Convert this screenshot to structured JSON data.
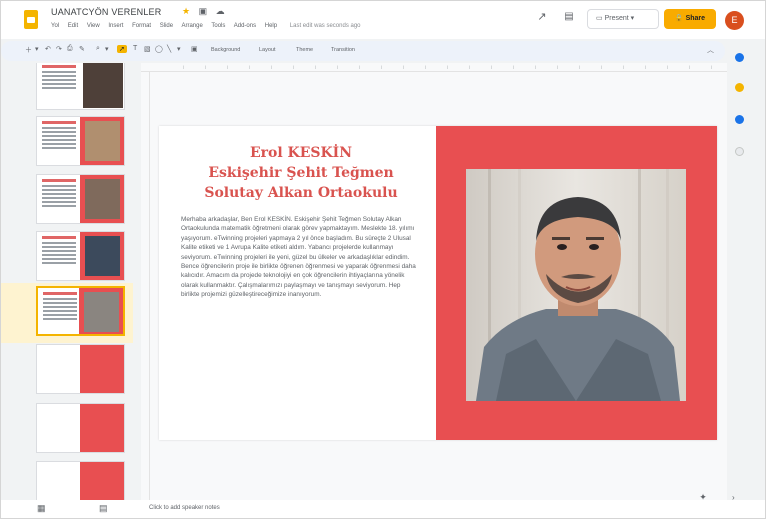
{
  "app": {
    "title": "UANATCYÖN VERENLER",
    "menu": [
      "Yol",
      "Edit",
      "View",
      "Insert",
      "Format",
      "Slide",
      "Arrange",
      "Tools",
      "Add-ons",
      "Help"
    ],
    "last_edit": "Last edit was seconds ago"
  },
  "header": {
    "present_label": "Present",
    "share_label": "Share",
    "avatar_letter": "E"
  },
  "toolbar": {
    "background_label": "Background",
    "layout_label": "Layout",
    "theme_label": "Theme",
    "transition_label": "Transition"
  },
  "filmstrip": {
    "slide_numbers": [
      "",
      "",
      "",
      "",
      "",
      "",
      "",
      ""
    ],
    "selected_index": 4
  },
  "slide": {
    "title_line1": "Erol KESKİN",
    "title_line2": "Eskişehir Şehit Teğmen",
    "title_line3": "Solutay Alkan Ortaokulu",
    "body": "Merhaba arkadaşlar, Ben Erol KESKİN. Eskişehir Şehit Teğmen Solutay Alkan Ortaokulunda matematik öğretmeni olarak görev yapmaktayım. Meslekte 18. yılımı yaşıyorum. eTwinning projeleri yapmaya 2 yıl önce başladım. Bu süreçte 2 Ulusal Kalite etiketi ve 1 Avrupa Kalite etiketi aldım. Yabancı projelerde kullanmayı seviyorum. eTwinning projeleri ile yeni, güzel bu ülkeler ve arkadaşlıklar edindim. Bence öğrencilerin proje ile birlikte öğrenen öğrenmesi ve yaparak öğrenmesi daha kalıcıdır. Amacım da projede teknolojiyi en çok öğrencilerin ihtiyaçlarına yönelik olarak kullanmaktır. Çalışmalarımızı paylaşmayı ve tanışmayı seviyorum. Hep birlikte projemizi güzelleştireceğimize inanıyorum."
  },
  "bottom": {
    "notes_hint": "Click to add speaker notes"
  },
  "colors": {
    "accent_red": "#e84f51",
    "title_red": "#d9534f",
    "share_yellow": "#f9ab00"
  }
}
